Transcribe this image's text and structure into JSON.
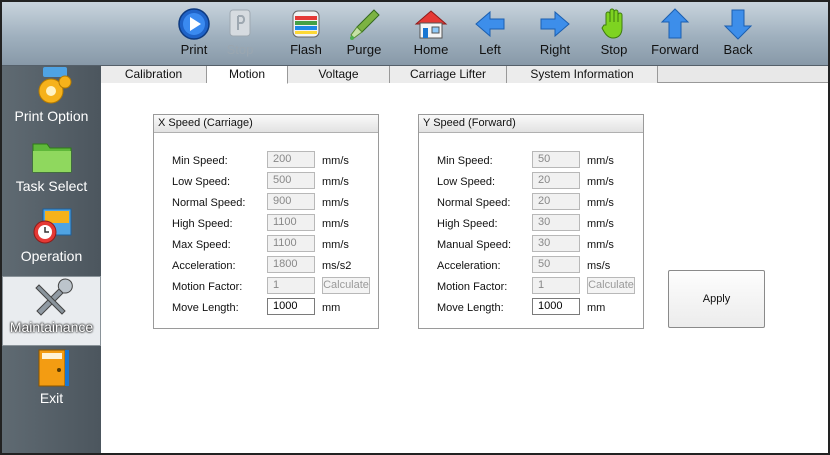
{
  "toolbar": {
    "buttons": [
      {
        "label": "Print",
        "icon": "play-icon",
        "enabled": true
      },
      {
        "label": "Stop",
        "icon": "stop-icon",
        "enabled": false
      },
      {
        "label": "Flash",
        "icon": "flash-icon",
        "enabled": true
      },
      {
        "label": "Purge",
        "icon": "dropper-icon",
        "enabled": true
      },
      {
        "label": "Home",
        "icon": "home-icon",
        "enabled": true
      },
      {
        "label": "Left",
        "icon": "arrow-left-icon",
        "enabled": true
      },
      {
        "label": "Right",
        "icon": "arrow-right-icon",
        "enabled": true
      },
      {
        "label": "Stop",
        "icon": "hand-stop-icon",
        "enabled": true
      },
      {
        "label": "Forward",
        "icon": "arrow-up-icon",
        "enabled": true
      },
      {
        "label": "Back",
        "icon": "arrow-down-icon",
        "enabled": true
      }
    ]
  },
  "sidebar": {
    "items": [
      {
        "label": "Print Option",
        "icon": "gear-icon",
        "active": false
      },
      {
        "label": "Task Select",
        "icon": "folder-icon",
        "active": false
      },
      {
        "label": "Operation",
        "icon": "clock-icon",
        "active": false
      },
      {
        "label": "Maintainance",
        "icon": "tools-icon",
        "active": true
      },
      {
        "label": "Exit",
        "icon": "exit-door-icon",
        "active": false
      }
    ]
  },
  "tabs": [
    {
      "label": "Calibration",
      "active": false
    },
    {
      "label": "Motion",
      "active": true
    },
    {
      "label": "Voltage",
      "active": false
    },
    {
      "label": "Carriage Lifter",
      "active": false
    },
    {
      "label": "System Information",
      "active": false
    }
  ],
  "x_speed": {
    "title": "X Speed (Carriage)",
    "rows": [
      {
        "label": "Min Speed:",
        "value": "200",
        "unit": "mm/s",
        "editable": false
      },
      {
        "label": "Low Speed:",
        "value": "500",
        "unit": "mm/s",
        "editable": false
      },
      {
        "label": "Normal Speed:",
        "value": "900",
        "unit": "mm/s",
        "editable": false
      },
      {
        "label": "High Speed:",
        "value": "1100",
        "unit": "mm/s",
        "editable": false
      },
      {
        "label": "Max Speed:",
        "value": "1100",
        "unit": "mm/s",
        "editable": false
      },
      {
        "label": "Acceleration:",
        "value": "1800",
        "unit": "ms/s2",
        "editable": false
      },
      {
        "label": "Motion Factor:",
        "value": "1",
        "button": "Calculate",
        "editable": false
      },
      {
        "label": "Move Length:",
        "value": "1000",
        "unit": "mm",
        "editable": true
      }
    ]
  },
  "y_speed": {
    "title": "Y Speed (Forward)",
    "rows": [
      {
        "label": "Min Speed:",
        "value": "50",
        "unit": "mm/s",
        "editable": false
      },
      {
        "label": "Low Speed:",
        "value": "20",
        "unit": "mm/s",
        "editable": false
      },
      {
        "label": "Normal Speed:",
        "value": "20",
        "unit": "mm/s",
        "editable": false
      },
      {
        "label": "High Speed:",
        "value": "30",
        "unit": "mm/s",
        "editable": false
      },
      {
        "label": "Manual Speed:",
        "value": "30",
        "unit": "mm/s",
        "editable": false
      },
      {
        "label": "Acceleration:",
        "value": "50",
        "unit": "ms/s",
        "editable": false
      },
      {
        "label": "Motion Factor:",
        "value": "1",
        "button": "Calculate",
        "editable": false
      },
      {
        "label": "Move Length:",
        "value": "1000",
        "unit": "mm",
        "editable": true
      }
    ]
  },
  "apply_label": "Apply",
  "colors": {
    "toolbar": "#9fb0be",
    "sidebar": "#566068",
    "accent_blue": "#2f7fe0"
  }
}
